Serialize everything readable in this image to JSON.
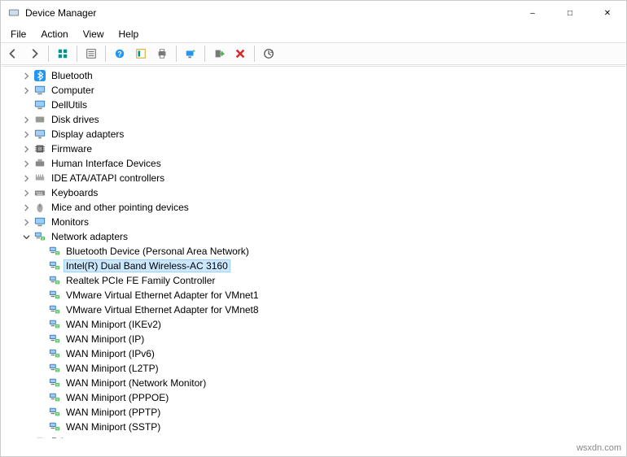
{
  "window": {
    "title": "Device Manager"
  },
  "menubar": {
    "items": [
      "File",
      "Action",
      "View",
      "Help"
    ]
  },
  "toolbar": {
    "buttons": [
      "back",
      "forward",
      "sep",
      "show-hidden",
      "sep",
      "properties",
      "sep",
      "help",
      "action-center",
      "print",
      "sep",
      "scan",
      "sep",
      "enable-device",
      "disable-device",
      "sep",
      "update-driver"
    ]
  },
  "tree": [
    {
      "label": "Bluetooth",
      "icon": "bluetooth",
      "depth": 1,
      "expander": "collapsed"
    },
    {
      "label": "Computer",
      "icon": "monitor",
      "depth": 1,
      "expander": "collapsed"
    },
    {
      "label": "DellUtils",
      "icon": "monitor",
      "depth": 1,
      "expander": "none"
    },
    {
      "label": "Disk drives",
      "icon": "disk",
      "depth": 1,
      "expander": "collapsed"
    },
    {
      "label": "Display adapters",
      "icon": "display",
      "depth": 1,
      "expander": "collapsed"
    },
    {
      "label": "Firmware",
      "icon": "firmware",
      "depth": 1,
      "expander": "collapsed"
    },
    {
      "label": "Human Interface Devices",
      "icon": "hid",
      "depth": 1,
      "expander": "collapsed"
    },
    {
      "label": "IDE ATA/ATAPI controllers",
      "icon": "ide",
      "depth": 1,
      "expander": "collapsed"
    },
    {
      "label": "Keyboards",
      "icon": "keyboard",
      "depth": 1,
      "expander": "collapsed"
    },
    {
      "label": "Mice and other pointing devices",
      "icon": "mouse",
      "depth": 1,
      "expander": "collapsed"
    },
    {
      "label": "Monitors",
      "icon": "monitor",
      "depth": 1,
      "expander": "collapsed"
    },
    {
      "label": "Network adapters",
      "icon": "network",
      "depth": 1,
      "expander": "expanded"
    },
    {
      "label": "Bluetooth Device (Personal Area Network)",
      "icon": "network",
      "depth": 2,
      "expander": "none"
    },
    {
      "label": "Intel(R) Dual Band Wireless-AC 3160",
      "icon": "network",
      "depth": 2,
      "expander": "none",
      "selected": true
    },
    {
      "label": "Realtek PCIe FE Family Controller",
      "icon": "network",
      "depth": 2,
      "expander": "none"
    },
    {
      "label": "VMware Virtual Ethernet Adapter for VMnet1",
      "icon": "network",
      "depth": 2,
      "expander": "none"
    },
    {
      "label": "VMware Virtual Ethernet Adapter for VMnet8",
      "icon": "network",
      "depth": 2,
      "expander": "none"
    },
    {
      "label": "WAN Miniport (IKEv2)",
      "icon": "network",
      "depth": 2,
      "expander": "none"
    },
    {
      "label": "WAN Miniport (IP)",
      "icon": "network",
      "depth": 2,
      "expander": "none"
    },
    {
      "label": "WAN Miniport (IPv6)",
      "icon": "network",
      "depth": 2,
      "expander": "none"
    },
    {
      "label": "WAN Miniport (L2TP)",
      "icon": "network",
      "depth": 2,
      "expander": "none"
    },
    {
      "label": "WAN Miniport (Network Monitor)",
      "icon": "network",
      "depth": 2,
      "expander": "none"
    },
    {
      "label": "WAN Miniport (PPPOE)",
      "icon": "network",
      "depth": 2,
      "expander": "none"
    },
    {
      "label": "WAN Miniport (PPTP)",
      "icon": "network",
      "depth": 2,
      "expander": "none"
    },
    {
      "label": "WAN Miniport (SSTP)",
      "icon": "network",
      "depth": 2,
      "expander": "none"
    },
    {
      "label": "Print queues",
      "icon": "printer",
      "depth": 1,
      "expander": "collapsed"
    }
  ],
  "watermark": "wsxdn.com"
}
